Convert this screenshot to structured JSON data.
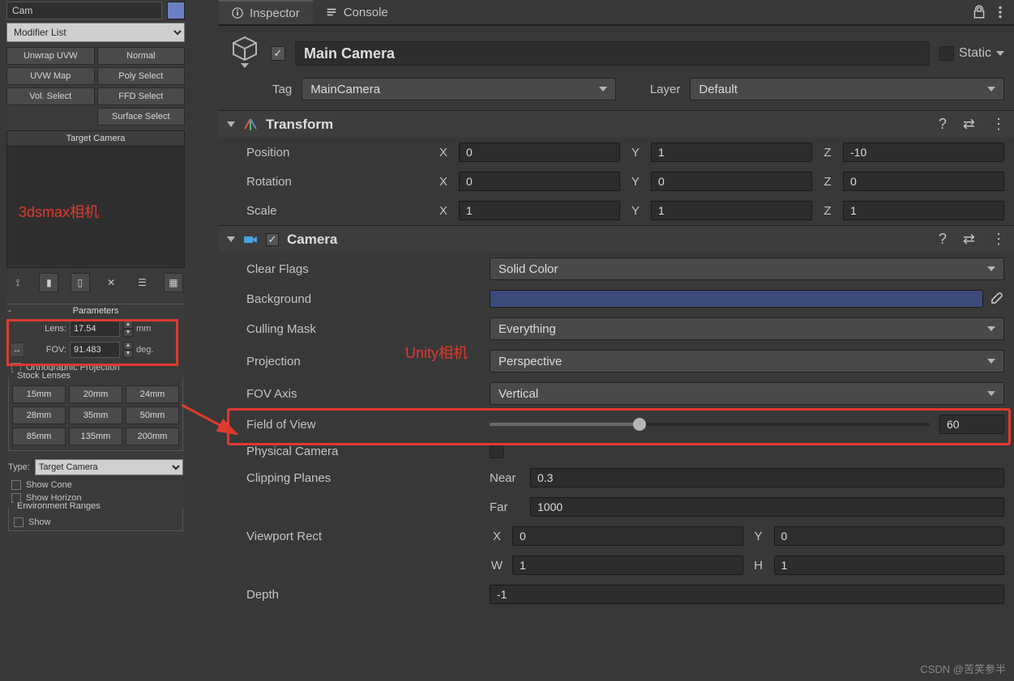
{
  "max": {
    "topInput": "Cam",
    "modListPlaceholder": "Modifier List",
    "buttons": [
      "Unwrap UVW",
      "Normal",
      "UVW Map",
      "Poly Select",
      "Vol. Select",
      "FFD Select",
      "Surface Select"
    ],
    "stackHeader": "Target Camera",
    "stackAnnotation": "3dsmax相机",
    "paramsTitle": "Parameters",
    "lensLabel": "Lens:",
    "lensValue": "17.54",
    "lensUnit": "mm",
    "fovLabel": "FOV:",
    "fovValue": "91.483",
    "fovUnit": "deg.",
    "orthoLabel": "Orthographic Projection",
    "stockGroup": "Stock Lenses",
    "lensesRow1": [
      "15mm",
      "20mm",
      "24mm"
    ],
    "lensesRow2": [
      "28mm",
      "35mm",
      "50mm"
    ],
    "lensesRow3": [
      "85mm",
      "135mm",
      "200mm"
    ],
    "typeLabel": "Type:",
    "typeValue": "Target Camera",
    "showCone": "Show Cone",
    "showHorizon": "Show Horizon",
    "envGroup": "Environment Ranges",
    "envShow": "Show"
  },
  "unity": {
    "tabInspector": "Inspector",
    "tabConsole": "Console",
    "objectName": "Main Camera",
    "staticLabel": "Static",
    "tagLabel": "Tag",
    "tagValue": "MainCamera",
    "layerLabel": "Layer",
    "layerValue": "Default",
    "transform": {
      "title": "Transform",
      "position": {
        "label": "Position",
        "x": "0",
        "y": "1",
        "z": "-10"
      },
      "rotation": {
        "label": "Rotation",
        "x": "0",
        "y": "0",
        "z": "0"
      },
      "scale": {
        "label": "Scale",
        "x": "1",
        "y": "1",
        "z": "1"
      }
    },
    "camera": {
      "title": "Camera",
      "clearFlagsLabel": "Clear Flags",
      "clearFlagsValue": "Solid Color",
      "backgroundLabel": "Background",
      "cullingLabel": "Culling Mask",
      "cullingValue": "Everything",
      "projectionLabel": "Projection",
      "projectionValue": "Perspective",
      "fovAxisLabel": "FOV Axis",
      "fovAxisValue": "Vertical",
      "fovLabel": "Field of View",
      "fovValue": "60",
      "physCamLabel": "Physical Camera",
      "clipLabel": "Clipping Planes",
      "nearLabel": "Near",
      "nearValue": "0.3",
      "farLabel": "Far",
      "farValue": "1000",
      "viewportLabel": "Viewport Rect",
      "vx": "0",
      "vy": "0",
      "vw": "1",
      "vh": "1",
      "depthLabel": "Depth",
      "depthValue": "-1"
    },
    "annotation": "Unity相机"
  },
  "watermark": "CSDN @苦笑参半"
}
